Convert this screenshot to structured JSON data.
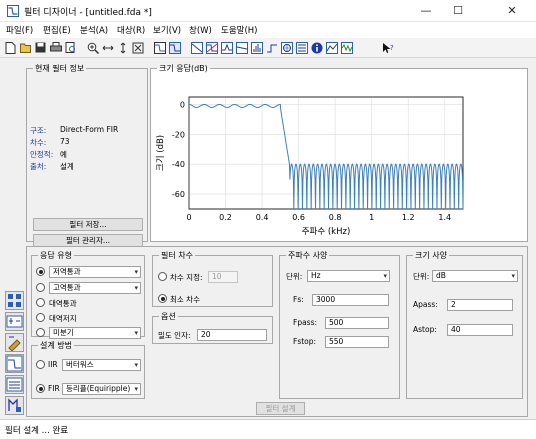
{
  "window": {
    "title": "필터 디자이너 - [untitled.fda *]",
    "minimize": "—",
    "maximize": "☐",
    "close": "✕"
  },
  "menu": [
    "파일(F)",
    "편집(E)",
    "분석(A)",
    "대상(R)",
    "보기(V)",
    "창(W)",
    "도움말(H)"
  ],
  "toolbar": {
    "icons": [
      "new-icon",
      "open-icon",
      "save-icon",
      "print-icon",
      "print-preview-icon",
      "zoom-in-icon",
      "zoom-x-icon",
      "zoom-y-icon",
      "full-view-icon",
      "filter-spec-icon",
      "magnitude-response-icon",
      "phase-response-icon",
      "magnitude-phase-icon",
      "group-delay-icon",
      "phase-delay-icon",
      "impulse-response-icon",
      "step-response-icon",
      "pole-zero-icon",
      "filter-coefficients-icon",
      "filter-info-icon",
      "magnitude-estimate-icon",
      "noise-power-icon",
      "whats-this-icon"
    ]
  },
  "filter_info": {
    "title": "현재 필터 정보",
    "rows": [
      {
        "label": "구조:",
        "value": "Direct-Form FIR"
      },
      {
        "label": "차수:",
        "value": "73"
      },
      {
        "label": "안정적:",
        "value": "예"
      },
      {
        "label": "출처:",
        "value": "설계"
      }
    ],
    "store_button": "필터 저장...",
    "manager_button": "필터 관리자..."
  },
  "chart_data": {
    "type": "line",
    "title": "크기 응답(dB)",
    "xlabel": "주파수 (kHz)",
    "ylabel": "크기 (dB)",
    "xlim": [
      0,
      1.5
    ],
    "ylim": [
      -70,
      5
    ],
    "xticks": [
      "0",
      "0.2",
      "0.4",
      "0.6",
      "0.8",
      "1",
      "1.2",
      "1.4"
    ],
    "yticks": [
      "0",
      "-20",
      "-40",
      "-60"
    ],
    "grid": true,
    "passband_edge": 0.5,
    "stopband_edge": 0.55,
    "passband_ripple_db": 2,
    "stopband_level_db": -40,
    "series": [
      {
        "color": "#3b7fc4"
      }
    ]
  },
  "response_type": {
    "title": "응답 유형",
    "options": [
      {
        "label": "저역통과",
        "checked": true,
        "dropdown": true
      },
      {
        "label": "고역통과",
        "checked": false,
        "dropdown": true
      },
      {
        "label": "대역통과",
        "checked": false,
        "dropdown": false
      },
      {
        "label": "대역저지",
        "checked": false,
        "dropdown": false
      },
      {
        "label": "미분기",
        "checked": false,
        "dropdown": true
      }
    ]
  },
  "design_method": {
    "title": "설계 방법",
    "iir_label": "IIR",
    "iir_value": "버터워스",
    "fir_label": "FIR",
    "fir_value": "등리플(Equiripple)"
  },
  "filter_order": {
    "title": "필터 차수",
    "specify_label": "차수 지정:",
    "specify_value": "10",
    "min_label": "최소 차수"
  },
  "options": {
    "title": "옵션",
    "density_label": "밀도 인자:",
    "density_value": "20"
  },
  "freq_spec": {
    "title": "주파수 사양",
    "units_label": "단위:",
    "units_value": "Hz",
    "fs_label": "Fs:",
    "fs_value": "3000",
    "fpass_label": "Fpass:",
    "fpass_value": "500",
    "fstop_label": "Fstop:",
    "fstop_value": "550"
  },
  "mag_spec": {
    "title": "크기 사양",
    "units_label": "단위:",
    "units_value": "dB",
    "apass_label": "Apass:",
    "apass_value": "2",
    "astop_label": "Astop:",
    "astop_value": "40"
  },
  "design_button": "필터 설계",
  "status": "필터 설계 ... 완료"
}
